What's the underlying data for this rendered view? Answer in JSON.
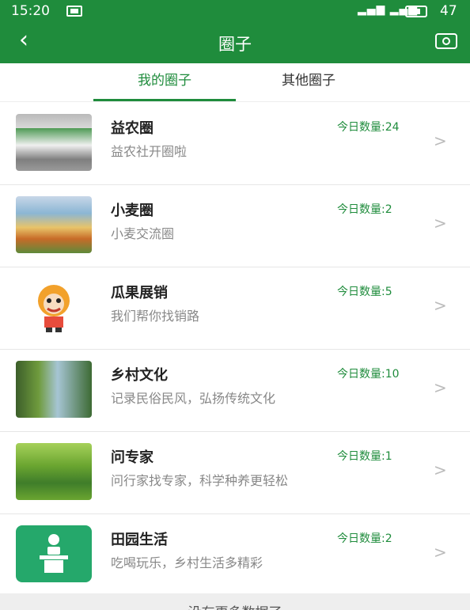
{
  "status_bar": {
    "time": "15:20",
    "signal": "&#8203;",
    "battery": "47"
  },
  "header": {
    "title": "圈子"
  },
  "tabs": [
    {
      "label": "我的圈子",
      "active": true
    },
    {
      "label": "其他圈子",
      "active": false
    }
  ],
  "circles": [
    {
      "name": "益农圈",
      "desc": "益农社开圈啦",
      "count": "今日数量:24"
    },
    {
      "name": "小麦圈",
      "desc": "小麦交流圈",
      "count": "今日数量:2"
    },
    {
      "name": "瓜果展销",
      "desc": "我们帮你找销路",
      "count": "今日数量:5"
    },
    {
      "name": "乡村文化",
      "desc": "记录民俗民风，弘扬传统文化",
      "count": "今日数量:10"
    },
    {
      "name": "问专家",
      "desc": "问行家找专家，科学种养更轻松",
      "count": "今日数量:1"
    },
    {
      "name": "田园生活",
      "desc": "吃喝玩乐，乡村生活多精彩",
      "count": "今日数量:2"
    }
  ],
  "footer": {
    "text": "没有更多数据了"
  },
  "colors": {
    "primary": "#1f8c3c",
    "count_text": "#1f8c3c"
  }
}
